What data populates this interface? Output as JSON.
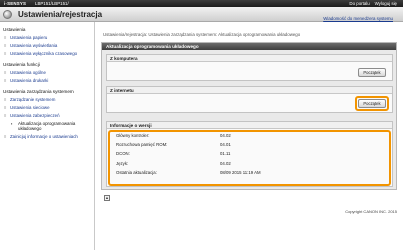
{
  "topbar": {
    "brand": "i-SENSYS",
    "model": "LBP151/LBP151/",
    "portal": "Do portalu",
    "logout": "Wyloguj się"
  },
  "header": {
    "title": "Ustawienia/rejestracja",
    "monitor_link": "Wiadomość do menedżera systemu"
  },
  "sidebar": {
    "sections": [
      {
        "label": "Ustawienia",
        "items": [
          "Ustawienia papieru",
          "Ustawienia wyświetlania",
          "Ustawienia wyłącznika czasowego"
        ]
      },
      {
        "label": "Ustawienia funkcji",
        "items": [
          "Ustawienia ogólne",
          "Ustawienia drukarki"
        ]
      },
      {
        "label": "Ustawienia zarządzania systemem",
        "items": [
          "Zarządzanie systemem",
          "Ustawienia sieciowe",
          "Ustawienia zabezpieczeń"
        ]
      }
    ],
    "active_item": "Aktualizacja oprogramowania układowego",
    "last_item": "Zainicjuj informacje o ustawieniach"
  },
  "main": {
    "breadcrumb": "Ustawienia/rejestracja: Ustawienia zarządzania systemem: Aktualizacja oprogramowania układowego",
    "panel_title": "Aktualizacja oprogramowania układowego",
    "from_computer": {
      "title": "Z komputera",
      "button": "Początek"
    },
    "from_internet": {
      "title": "Z internetu",
      "button": "Początek"
    },
    "version_info": {
      "title": "Informacje o wersji",
      "rows": [
        {
          "label": "Główny kontroler:",
          "value": "04.02"
        },
        {
          "label": "Rozruchowa pamięć ROM:",
          "value": "04.01"
        },
        {
          "label": "DCON:",
          "value": "01.11"
        },
        {
          "label": "Język:",
          "value": "04.02"
        },
        {
          "label": "Ostatnia aktualizacja:",
          "value": "08/09 2015 11:19 AM"
        }
      ]
    },
    "copyright": "Copyright CANON INC. 2015"
  },
  "colors": {
    "highlight": "#f29400",
    "link": "#1a3b8f",
    "panel_header": "#4a4a4a"
  }
}
